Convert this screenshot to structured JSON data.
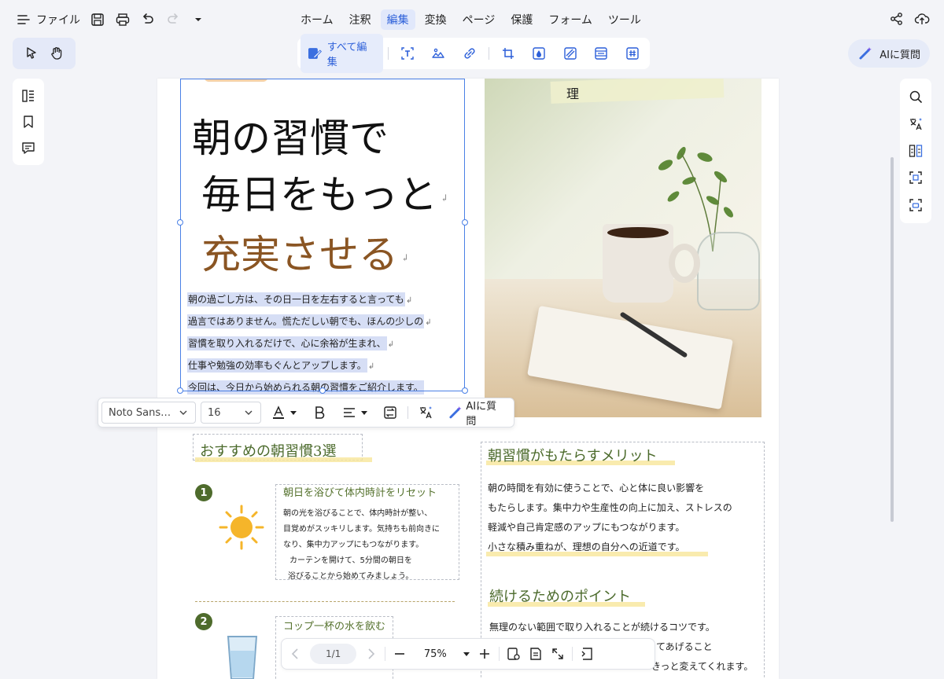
{
  "menubar": {
    "file_label": "ファイル",
    "tabs": [
      "ホーム",
      "注釈",
      "編集",
      "変換",
      "ページ",
      "保護",
      "フォーム",
      "ツール"
    ],
    "active_tab": "編集"
  },
  "edit_toolbar": {
    "edit_all_label": "すべて編集"
  },
  "ai_button_label": "AIに質問",
  "format_toolbar": {
    "font_family": "Noto Sans…",
    "font_size": "16",
    "ai_label": "AIに質問"
  },
  "document": {
    "tape_text": "理",
    "title_lines": [
      "朝の習慣で",
      "毎日をもっと",
      "充実させる"
    ],
    "return_mark": "↲",
    "intro_lines": [
      "朝の過ごし方は、その日一日を左右すると言っても",
      "過言ではありません。慌ただしい朝でも、ほんの少しの",
      "習慣を取り入れるだけで、心に余裕が生まれ、",
      "仕事や勉強の効率もぐんとアップします。",
      "今回は、今日から始められる朝の習慣をご紹介します。"
    ],
    "section_left_title": "おすすめの朝習慣3選",
    "items": [
      {
        "number": "1",
        "title": "朝日を浴びて体内時計をリセット",
        "lines": [
          "朝の光を浴びることで、体内時計が整い、",
          "目覚めがスッキリします。気持ちも前向きに",
          "なり、集中力アップにもつながります。",
          "カーテンを開けて、5分間の朝日を",
          "浴びることから始めてみましょう。"
        ]
      },
      {
        "number": "2",
        "title": "コップ一杯の水を飲む"
      }
    ],
    "benefits_title": "朝習慣がもたらすメリット",
    "benefits_lines": [
      "朝の時間を有効に使うことで、心と体に良い影響を",
      "もたらします。集中力や生産性の向上に加え、ストレスの",
      "軽減や自己肯定感のアップにもつながります。",
      "小さな積み重ねが、理想の自分への近道です。"
    ],
    "points_title": "続けるためのポイント",
    "points_lines": [
      "無理のない範囲で取り入れることが続けるコツです。",
      "めてあげること",
      "きっと変えてくれます。"
    ]
  },
  "status_bar": {
    "page_indicator": "1/1",
    "zoom": "75%"
  },
  "colors": {
    "accent": "#2c5fd9",
    "selection": "#4a80e6",
    "heading_green": "#4b6a2b"
  }
}
